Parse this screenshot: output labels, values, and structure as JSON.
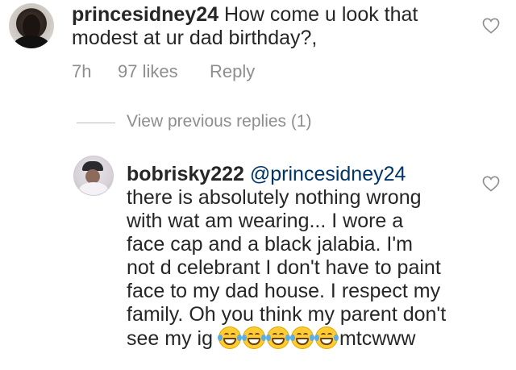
{
  "comment": {
    "username": "princesidney24",
    "text": " How come u look that",
    "text_line2": "modest at ur dad birthday?,",
    "time": "7h",
    "likes": "97 likes",
    "reply_label": "Reply"
  },
  "view_replies": "View previous replies (1)",
  "reply": {
    "username": "bobrisky222",
    "mention": "@princesidney24",
    "lines": [
      "there is absolutely nothing wrong",
      "with wat am wearing... I wore a",
      "face cap and a black jalabia. I'm",
      "not d celebrant I don't have to paint",
      "face to my dad house. I respect my",
      "family. Oh you think my parent don't"
    ],
    "last_line_text": "see my ig ",
    "emoji_name": "grinning-squinting-tears-face",
    "emoji_count": 5,
    "last_line_tail": "mtcwww"
  },
  "icons": {
    "like": "heart-outline-icon"
  },
  "colors": {
    "text": "#262626",
    "meta": "#8e8e8e",
    "mention": "#003569"
  }
}
